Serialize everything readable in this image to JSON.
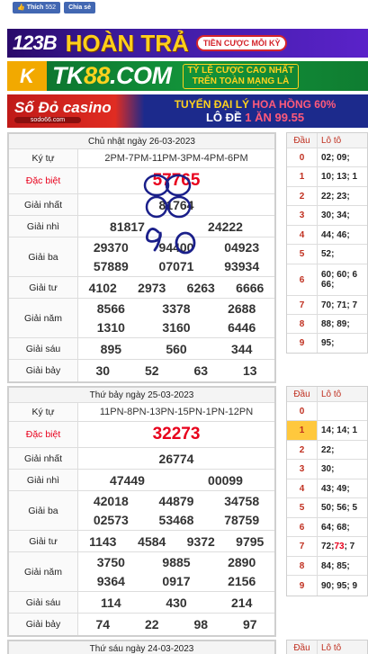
{
  "social": {
    "like_label": "Thích",
    "like_count": "552",
    "share_label": "Chia sẻ"
  },
  "banners": {
    "b1": {
      "logo": "123B",
      "main": "HOÀN TRẢ",
      "badge": "TIỀN CƯỢC MỖI KỲ"
    },
    "b2": {
      "logo": "K",
      "main_a": "TK",
      "main_b": "88",
      "main_c": ".COM",
      "side_1": "TỶ LỆ CƯỢC CAO NHẤT",
      "side_2": "TRÊN TOÀN MẠNG LÀ"
    },
    "b3": {
      "logo": "Số Đỏ casino",
      "logo_sub": "sodo66.com",
      "l1_a": "TUYỂN ĐẠI LÝ",
      "l1_b": "HOA HỒNG 60%",
      "l2_a": "LÔ ĐỀ",
      "l2_b": "1 ĂN 99.55"
    }
  },
  "panels": [
    {
      "title": "Chủ nhật ngày 26-03-2023",
      "labels": {
        "kytu": "Ký tự",
        "db": "Đặc biệt",
        "g1": "Giải nhất",
        "g2": "Giải nhì",
        "g3": "Giải ba",
        "g4": "Giải tư",
        "g5": "Giải năm",
        "g6": "Giải sáu",
        "g7": "Giải bảy"
      },
      "kytu": "2PM-7PM-11PM-3PM-4PM-6PM",
      "db": "57765",
      "g1": "81764",
      "g2": [
        "81817",
        "24222"
      ],
      "g3": [
        [
          "29370",
          "94400",
          "04923"
        ],
        [
          "57889",
          "07071",
          "93934"
        ]
      ],
      "g4": [
        "4102",
        "2973",
        "6263",
        "6666"
      ],
      "g5": [
        [
          "8566",
          "3378",
          "2688"
        ],
        [
          "1310",
          "3160",
          "6446"
        ]
      ],
      "g6": [
        "895",
        "560",
        "344"
      ],
      "g7": [
        "30",
        "52",
        "63",
        "13"
      ]
    },
    {
      "title": "Thứ bảy ngày 25-03-2023",
      "labels": {
        "kytu": "Ký tự",
        "db": "Đặc biệt",
        "g1": "Giải nhất",
        "g2": "Giải nhì",
        "g3": "Giải ba",
        "g4": "Giải tư",
        "g5": "Giải năm",
        "g6": "Giải sáu",
        "g7": "Giải bảy"
      },
      "kytu": "11PN-8PN-13PN-15PN-1PN-12PN",
      "db": "32273",
      "g1": "26774",
      "g2": [
        "47449",
        "00099"
      ],
      "g3": [
        [
          "42018",
          "44879",
          "34758"
        ],
        [
          "02573",
          "53468",
          "78759"
        ]
      ],
      "g4": [
        "1143",
        "4584",
        "9372",
        "9795"
      ],
      "g5": [
        [
          "3750",
          "9885",
          "2890"
        ],
        [
          "9364",
          "0917",
          "2156"
        ]
      ],
      "g6": [
        "114",
        "430",
        "214"
      ],
      "g7": [
        "74",
        "22",
        "98",
        "97"
      ]
    },
    {
      "title": "Thứ sáu ngày 24-03-2023"
    }
  ],
  "side_tables": [
    {
      "head": {
        "dau": "Đầu",
        "loto": "Lô tô"
      },
      "rows": [
        {
          "k": "0",
          "v": "02; 09;"
        },
        {
          "k": "1",
          "v": "10; 13; 1"
        },
        {
          "k": "2",
          "v": "22; 23;"
        },
        {
          "k": "3",
          "v": "30; 34;"
        },
        {
          "k": "4",
          "v": "44; 46;"
        },
        {
          "k": "5",
          "v": "52;"
        },
        {
          "k": "6",
          "v": "60; 60; 6",
          "v2": "66;"
        },
        {
          "k": "7",
          "v": "70; 71; 7"
        },
        {
          "k": "8",
          "v": "88; 89;"
        },
        {
          "k": "9",
          "v": "95;"
        }
      ]
    },
    {
      "head": {
        "dau": "Đầu",
        "loto": "Lô tô"
      },
      "rows": [
        {
          "k": "0",
          "v": ""
        },
        {
          "k": "1",
          "v": "14; 14; 1"
        },
        {
          "k": "2",
          "v": "22;"
        },
        {
          "k": "3",
          "v": "30;"
        },
        {
          "k": "4",
          "v": "43; 49;"
        },
        {
          "k": "5",
          "v": "50; 56; 5"
        },
        {
          "k": "6",
          "v": "64; 68;"
        },
        {
          "k": "7",
          "v_a": "72; ",
          "v_b": "73",
          "v_c": "; 7"
        },
        {
          "k": "8",
          "v": "84; 85;"
        },
        {
          "k": "9",
          "v": "90; 95; 9"
        }
      ]
    },
    {
      "head": {
        "dau": "Đầu",
        "loto": "Lô tô"
      }
    }
  ],
  "annotations": {
    "circle_1": "00",
    "scribble": "9.0"
  }
}
